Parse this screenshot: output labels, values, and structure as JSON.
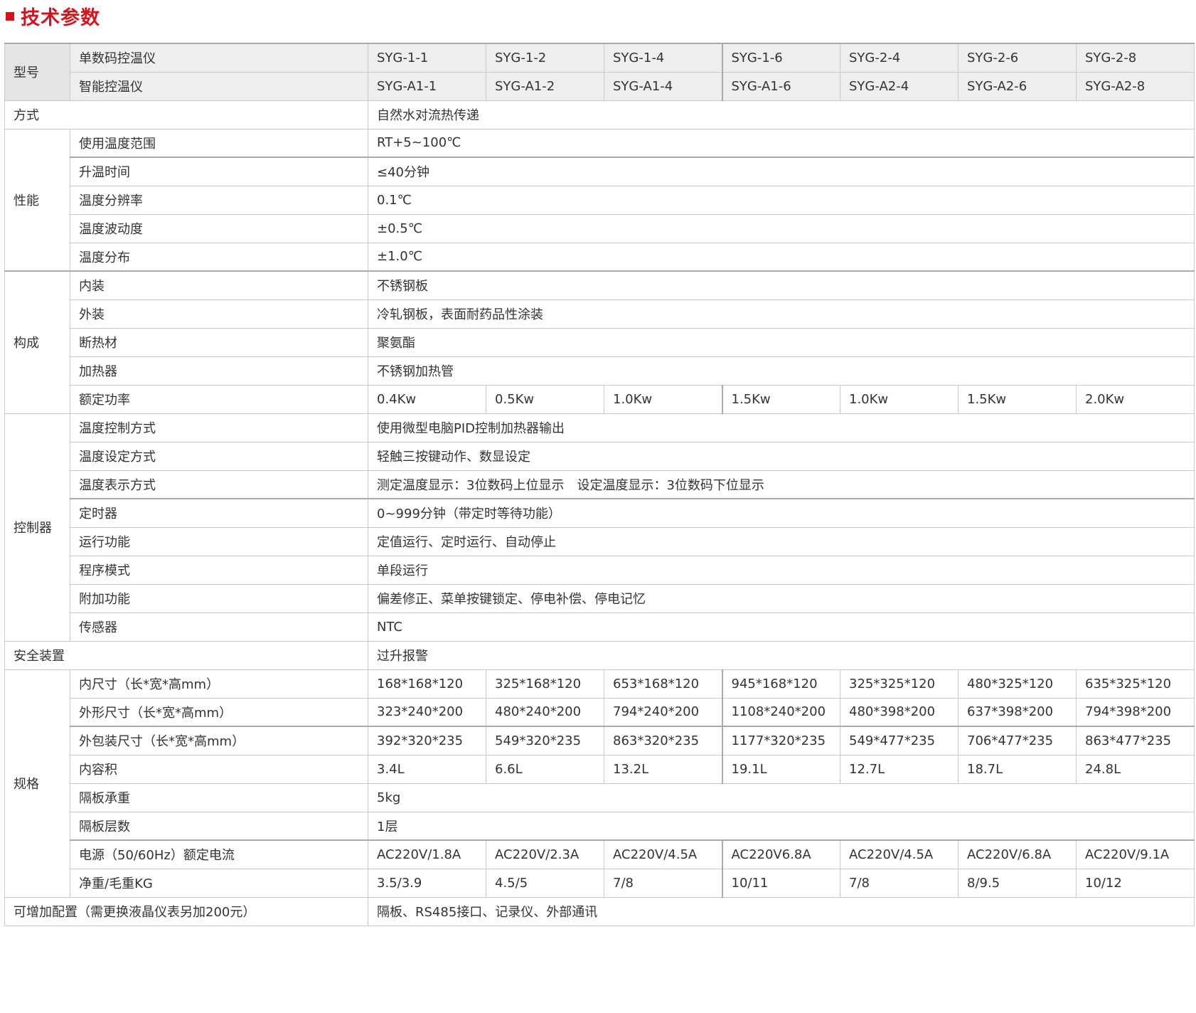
{
  "section_title": "技术参数",
  "table": {
    "model": {
      "group": "型号",
      "row1_label": "单数码控温仪",
      "row1": [
        "SYG-1-1",
        "SYG-1-2",
        "SYG-1-4",
        "SYG-1-6",
        "SYG-2-4",
        "SYG-2-6",
        "SYG-2-8"
      ],
      "row2_label": "智能控温仪",
      "row2": [
        "SYG-A1-1",
        "SYG-A1-2",
        "SYG-A1-4",
        "SYG-A1-6",
        "SYG-A2-4",
        "SYG-A2-6",
        "SYG-A2-8"
      ]
    },
    "method": {
      "label": "方式",
      "value": "自然水对流热传递"
    },
    "performance": {
      "group": "性能",
      "rows": [
        {
          "label": "使用温度范围",
          "value": "RT+5~100℃"
        },
        {
          "label": "升温时间",
          "value": "≤40分钟"
        },
        {
          "label": "温度分辨率",
          "value": "0.1℃"
        },
        {
          "label": "温度波动度",
          "value": "±0.5℃"
        },
        {
          "label": "温度分布",
          "value": "±1.0℃"
        }
      ]
    },
    "construction": {
      "group": "构成",
      "rows": [
        {
          "label": "内装",
          "value": "不锈钢板"
        },
        {
          "label": "外装",
          "value": "冷轧钢板，表面耐药品性涂装"
        },
        {
          "label": "断热材",
          "value": "聚氨酯"
        },
        {
          "label": "加热器",
          "value": "不锈钢加热管"
        }
      ],
      "power_label": "额定功率",
      "power": [
        "0.4Kw",
        "0.5Kw",
        "1.0Kw",
        "1.5Kw",
        "1.0Kw",
        "1.5Kw",
        "2.0Kw"
      ]
    },
    "controller": {
      "group": "控制器",
      "rows": [
        {
          "label": "温度控制方式",
          "value": "使用微型电脑PID控制加热器输出"
        },
        {
          "label": "温度设定方式",
          "value": "轻触三按键动作、数显设定"
        },
        {
          "label": "温度表示方式",
          "value": "测定温度显示：3位数码上位显示　设定温度显示：3位数码下位显示"
        },
        {
          "label": "定时器",
          "value": "0~999分钟（带定时等待功能）"
        },
        {
          "label": "运行功能",
          "value": "定值运行、定时运行、自动停止"
        },
        {
          "label": "程序模式",
          "value": "单段运行"
        },
        {
          "label": "附加功能",
          "value": "偏差修正、菜单按键锁定、停电补偿、停电记忆"
        },
        {
          "label": "传感器",
          "value": "NTC"
        }
      ]
    },
    "safety": {
      "label": "安全装置",
      "value": "过升报警"
    },
    "spec": {
      "group": "规格",
      "inner_size_label": "内尺寸（长*宽*高mm）",
      "inner_size": [
        "168*168*120",
        "325*168*120",
        "653*168*120",
        "945*168*120",
        "325*325*120",
        "480*325*120",
        "635*325*120"
      ],
      "outer_size_label": "外形尺寸（长*宽*高mm）",
      "outer_size": [
        "323*240*200",
        "480*240*200",
        "794*240*200",
        "1108*240*200",
        "480*398*200",
        "637*398*200",
        "794*398*200"
      ],
      "package_size_label": "外包装尺寸（长*宽*高mm）",
      "package_size": [
        "392*320*235",
        "549*320*235",
        "863*320*235",
        "1177*320*235",
        "549*477*235",
        "706*477*235",
        "863*477*235"
      ],
      "volume_label": "内容积",
      "volume": [
        "3.4L",
        "6.6L",
        "13.2L",
        "19.1L",
        "12.7L",
        "18.7L",
        "24.8L"
      ],
      "shelf_load_label": "隔板承重",
      "shelf_load": "5kg",
      "shelf_layers_label": "隔板层数",
      "shelf_layers": "1层",
      "power_supply_label": "电源（50/60Hz）额定电流",
      "power_supply": [
        "AC220V/1.8A",
        "AC220V/2.3A",
        "AC220V/4.5A",
        "AC220V6.8A",
        "AC220V/4.5A",
        "AC220V/6.8A",
        "AC220V/9.1A"
      ],
      "weight_label": "净重/毛重KG",
      "weight": [
        "3.5/3.9",
        "4.5/5",
        "7/8",
        "10/11",
        "7/8",
        "8/9.5",
        "10/12"
      ]
    },
    "options": {
      "label": "可增加配置（需更换液晶仪表另加200元）",
      "value": "隔板、RS485接口、记录仪、外部通讯"
    }
  },
  "colors": {
    "accent": "#d5121d",
    "header_bg": "#eeeeee",
    "border": "#c9c9c9"
  }
}
